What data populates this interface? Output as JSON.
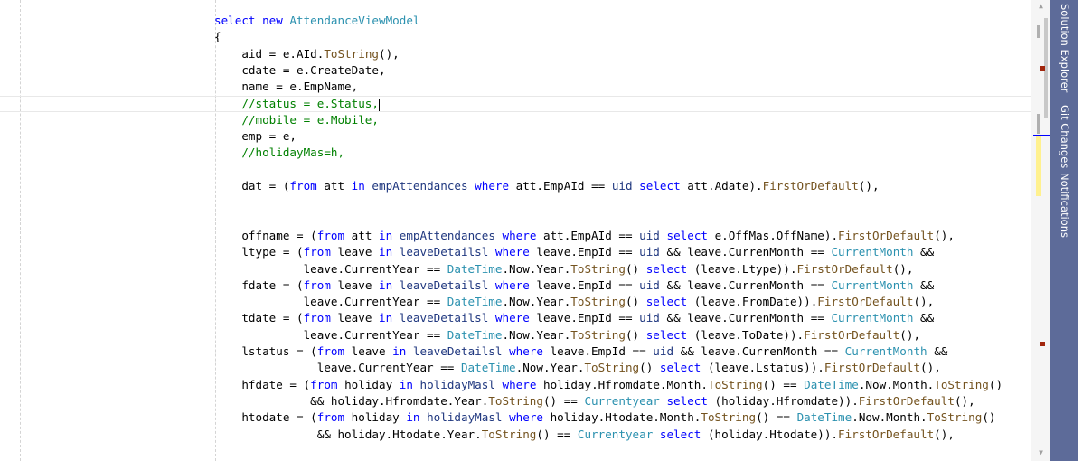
{
  "editor": {
    "lines": [
      [
        {
          "t": "select ",
          "c": "kw"
        },
        {
          "t": "new ",
          "c": "kw"
        },
        {
          "t": "AttendanceViewModel",
          "c": "type"
        }
      ],
      [
        {
          "t": "{",
          "c": "plain"
        }
      ],
      [
        {
          "t": "    aid = e.AId.",
          "c": "plain"
        },
        {
          "t": "ToString",
          "c": "method"
        },
        {
          "t": "(),",
          "c": "plain"
        }
      ],
      [
        {
          "t": "    cdate = e.CreateDate,",
          "c": "plain"
        }
      ],
      [
        {
          "t": "    name = e.EmpName,",
          "c": "plain"
        }
      ],
      [
        {
          "t": "    //status = e.Status,",
          "c": "comment"
        }
      ],
      [
        {
          "t": "    //mobile = e.Mobile,",
          "c": "comment"
        }
      ],
      [
        {
          "t": "    emp = e,",
          "c": "plain"
        }
      ],
      [
        {
          "t": "    //holidayMas=h,",
          "c": "comment"
        }
      ],
      [],
      [
        {
          "t": "    dat = (",
          "c": "plain"
        },
        {
          "t": "from ",
          "c": "kw"
        },
        {
          "t": "att ",
          "c": "plain"
        },
        {
          "t": "in ",
          "c": "kw"
        },
        {
          "t": "empAttendances ",
          "c": "var"
        },
        {
          "t": "where ",
          "c": "kw"
        },
        {
          "t": "att.EmpAId == ",
          "c": "plain"
        },
        {
          "t": "uid ",
          "c": "var"
        },
        {
          "t": "select ",
          "c": "kw"
        },
        {
          "t": "att.Adate).",
          "c": "plain"
        },
        {
          "t": "FirstOrDefault",
          "c": "method"
        },
        {
          "t": "(),",
          "c": "plain"
        }
      ],
      [],
      [],
      [
        {
          "t": "    offname = (",
          "c": "plain"
        },
        {
          "t": "from ",
          "c": "kw"
        },
        {
          "t": "att ",
          "c": "plain"
        },
        {
          "t": "in ",
          "c": "kw"
        },
        {
          "t": "empAttendances ",
          "c": "var"
        },
        {
          "t": "where ",
          "c": "kw"
        },
        {
          "t": "att.EmpAId == ",
          "c": "plain"
        },
        {
          "t": "uid ",
          "c": "var"
        },
        {
          "t": "select ",
          "c": "kw"
        },
        {
          "t": "e.OffMas.OffName).",
          "c": "plain"
        },
        {
          "t": "FirstOrDefault",
          "c": "method"
        },
        {
          "t": "(),",
          "c": "plain"
        }
      ],
      [
        {
          "t": "    ltype = (",
          "c": "plain"
        },
        {
          "t": "from ",
          "c": "kw"
        },
        {
          "t": "leave ",
          "c": "plain"
        },
        {
          "t": "in ",
          "c": "kw"
        },
        {
          "t": "leaveDetailsl ",
          "c": "var"
        },
        {
          "t": "where ",
          "c": "kw"
        },
        {
          "t": "leave.EmpId == ",
          "c": "plain"
        },
        {
          "t": "uid ",
          "c": "var"
        },
        {
          "t": "&& leave.CurrenMonth == ",
          "c": "plain"
        },
        {
          "t": "CurrentMonth ",
          "c": "type"
        },
        {
          "t": "&&",
          "c": "plain"
        }
      ],
      [
        {
          "t": "             leave.CurrentYear == ",
          "c": "plain"
        },
        {
          "t": "DateTime",
          "c": "type"
        },
        {
          "t": ".Now.Year.",
          "c": "plain"
        },
        {
          "t": "ToString",
          "c": "method"
        },
        {
          "t": "() ",
          "c": "plain"
        },
        {
          "t": "select ",
          "c": "kw"
        },
        {
          "t": "(leave.Ltype)).",
          "c": "plain"
        },
        {
          "t": "FirstOrDefault",
          "c": "method"
        },
        {
          "t": "(),",
          "c": "plain"
        }
      ],
      [
        {
          "t": "    fdate = (",
          "c": "plain"
        },
        {
          "t": "from ",
          "c": "kw"
        },
        {
          "t": "leave ",
          "c": "plain"
        },
        {
          "t": "in ",
          "c": "kw"
        },
        {
          "t": "leaveDetailsl ",
          "c": "var"
        },
        {
          "t": "where ",
          "c": "kw"
        },
        {
          "t": "leave.EmpId == ",
          "c": "plain"
        },
        {
          "t": "uid ",
          "c": "var"
        },
        {
          "t": "&& leave.CurrenMonth == ",
          "c": "plain"
        },
        {
          "t": "CurrentMonth ",
          "c": "type"
        },
        {
          "t": "&&",
          "c": "plain"
        }
      ],
      [
        {
          "t": "             leave.CurrentYear == ",
          "c": "plain"
        },
        {
          "t": "DateTime",
          "c": "type"
        },
        {
          "t": ".Now.Year.",
          "c": "plain"
        },
        {
          "t": "ToString",
          "c": "method"
        },
        {
          "t": "() ",
          "c": "plain"
        },
        {
          "t": "select ",
          "c": "kw"
        },
        {
          "t": "(leave.FromDate)).",
          "c": "plain"
        },
        {
          "t": "FirstOrDefault",
          "c": "method"
        },
        {
          "t": "(),",
          "c": "plain"
        }
      ],
      [
        {
          "t": "    tdate = (",
          "c": "plain"
        },
        {
          "t": "from ",
          "c": "kw"
        },
        {
          "t": "leave ",
          "c": "plain"
        },
        {
          "t": "in ",
          "c": "kw"
        },
        {
          "t": "leaveDetailsl ",
          "c": "var"
        },
        {
          "t": "where ",
          "c": "kw"
        },
        {
          "t": "leave.EmpId == ",
          "c": "plain"
        },
        {
          "t": "uid ",
          "c": "var"
        },
        {
          "t": "&& leave.CurrenMonth == ",
          "c": "plain"
        },
        {
          "t": "CurrentMonth ",
          "c": "type"
        },
        {
          "t": "&&",
          "c": "plain"
        }
      ],
      [
        {
          "t": "             leave.CurrentYear == ",
          "c": "plain"
        },
        {
          "t": "DateTime",
          "c": "type"
        },
        {
          "t": ".Now.Year.",
          "c": "plain"
        },
        {
          "t": "ToString",
          "c": "method"
        },
        {
          "t": "() ",
          "c": "plain"
        },
        {
          "t": "select ",
          "c": "kw"
        },
        {
          "t": "(leave.ToDate)).",
          "c": "plain"
        },
        {
          "t": "FirstOrDefault",
          "c": "method"
        },
        {
          "t": "(),",
          "c": "plain"
        }
      ],
      [
        {
          "t": "    lstatus = (",
          "c": "plain"
        },
        {
          "t": "from ",
          "c": "kw"
        },
        {
          "t": "leave ",
          "c": "plain"
        },
        {
          "t": "in ",
          "c": "kw"
        },
        {
          "t": "leaveDetailsl ",
          "c": "var"
        },
        {
          "t": "where ",
          "c": "kw"
        },
        {
          "t": "leave.EmpId == ",
          "c": "plain"
        },
        {
          "t": "uid ",
          "c": "var"
        },
        {
          "t": "&& leave.CurrenMonth == ",
          "c": "plain"
        },
        {
          "t": "CurrentMonth ",
          "c": "type"
        },
        {
          "t": "&&",
          "c": "plain"
        }
      ],
      [
        {
          "t": "               leave.CurrentYear == ",
          "c": "plain"
        },
        {
          "t": "DateTime",
          "c": "type"
        },
        {
          "t": ".Now.Year.",
          "c": "plain"
        },
        {
          "t": "ToString",
          "c": "method"
        },
        {
          "t": "() ",
          "c": "plain"
        },
        {
          "t": "select ",
          "c": "kw"
        },
        {
          "t": "(leave.Lstatus)).",
          "c": "plain"
        },
        {
          "t": "FirstOrDefault",
          "c": "method"
        },
        {
          "t": "(),",
          "c": "plain"
        }
      ],
      [
        {
          "t": "    hfdate = (",
          "c": "plain"
        },
        {
          "t": "from ",
          "c": "kw"
        },
        {
          "t": "holiday ",
          "c": "plain"
        },
        {
          "t": "in ",
          "c": "kw"
        },
        {
          "t": "holidayMasl ",
          "c": "var"
        },
        {
          "t": "where ",
          "c": "kw"
        },
        {
          "t": "holiday.Hfromdate.Month.",
          "c": "plain"
        },
        {
          "t": "ToString",
          "c": "method"
        },
        {
          "t": "() == ",
          "c": "plain"
        },
        {
          "t": "DateTime",
          "c": "type"
        },
        {
          "t": ".Now.Month.",
          "c": "plain"
        },
        {
          "t": "ToString",
          "c": "method"
        },
        {
          "t": "()",
          "c": "plain"
        }
      ],
      [
        {
          "t": "              && holiday.Hfromdate.Year.",
          "c": "plain"
        },
        {
          "t": "ToString",
          "c": "method"
        },
        {
          "t": "() == ",
          "c": "plain"
        },
        {
          "t": "Currentyear ",
          "c": "type"
        },
        {
          "t": "select ",
          "c": "kw"
        },
        {
          "t": "(holiday.Hfromdate)).",
          "c": "plain"
        },
        {
          "t": "FirstOrDefault",
          "c": "method"
        },
        {
          "t": "(),",
          "c": "plain"
        }
      ],
      [
        {
          "t": "    htodate = (",
          "c": "plain"
        },
        {
          "t": "from ",
          "c": "kw"
        },
        {
          "t": "holiday ",
          "c": "plain"
        },
        {
          "t": "in ",
          "c": "kw"
        },
        {
          "t": "holidayMasl ",
          "c": "var"
        },
        {
          "t": "where ",
          "c": "kw"
        },
        {
          "t": "holiday.Htodate.Month.",
          "c": "plain"
        },
        {
          "t": "ToString",
          "c": "method"
        },
        {
          "t": "() == ",
          "c": "plain"
        },
        {
          "t": "DateTime",
          "c": "type"
        },
        {
          "t": ".Now.Month.",
          "c": "plain"
        },
        {
          "t": "ToString",
          "c": "method"
        },
        {
          "t": "()",
          "c": "plain"
        }
      ],
      [
        {
          "t": "               && holiday.Htodate.Year.",
          "c": "plain"
        },
        {
          "t": "ToString",
          "c": "method"
        },
        {
          "t": "() == ",
          "c": "plain"
        },
        {
          "t": "Currentyear ",
          "c": "type"
        },
        {
          "t": "select ",
          "c": "kw"
        },
        {
          "t": "(holiday.Htodate)).",
          "c": "plain"
        },
        {
          "t": "FirstOrDefault",
          "c": "method"
        },
        {
          "t": "(),",
          "c": "plain"
        }
      ]
    ],
    "caret_line": 5,
    "colors": {
      "kw": "#0000ff",
      "type": "#2b91af",
      "method": "#74531f",
      "comment": "#008000",
      "var": "#1f377f",
      "plain": "#000000"
    }
  },
  "scrollbar": {
    "up_icon": "▲",
    "down_icon": "▼"
  },
  "side_tabs": [
    {
      "label": "Solution Explorer",
      "icon": "solution-explorer-icon"
    },
    {
      "label": "Git Changes",
      "icon": "git-changes-icon"
    },
    {
      "label": "Notifications",
      "icon": "notifications-icon"
    }
  ],
  "theme": {
    "side_tab_bg": "#5d6b99",
    "error_marker": "#a1260d",
    "change_marker": "#fff18f"
  }
}
